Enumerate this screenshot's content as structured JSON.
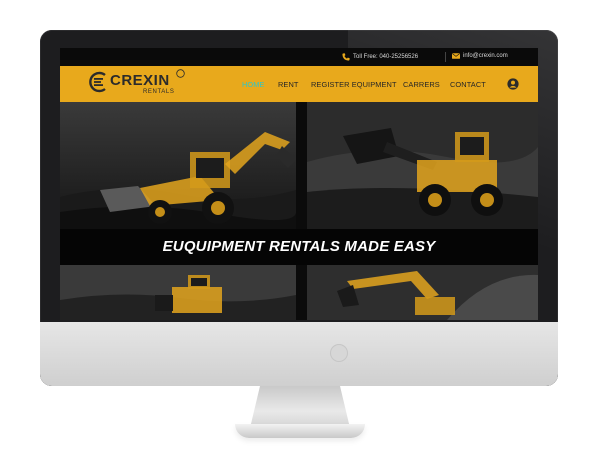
{
  "topbar": {
    "phone_label": "Toll Free: 040-25256526",
    "email_label": "info@crexin.com"
  },
  "brand": {
    "name": "CREXIN",
    "subtitle": "RENTALS"
  },
  "nav": {
    "items": [
      {
        "label": "HOME",
        "active": true
      },
      {
        "label": "RENT",
        "active": false
      },
      {
        "label": "REGISTER EQUIPMENT",
        "active": false
      },
      {
        "label": "CARRERS",
        "active": false
      },
      {
        "label": "CONTACT",
        "active": false
      }
    ]
  },
  "hero": {
    "tagline": "EUQUIPMENT RENTALS MADE EASY"
  },
  "colors": {
    "accent": "#e8a91c",
    "active_nav": "#2ec6c9",
    "machine_yellow": "#e3a51d"
  },
  "icons": [
    "phone-icon",
    "mail-icon",
    "user-account-icon",
    "crexin-logo-icon"
  ]
}
